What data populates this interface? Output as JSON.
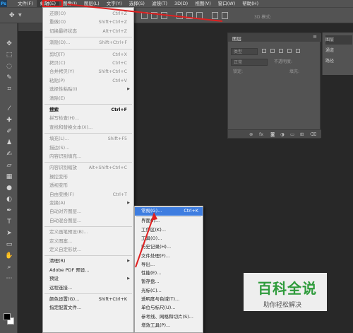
{
  "menubar": {
    "logo": "Ps",
    "items": [
      "文件(F)",
      "编辑(E)",
      "图像(I)",
      "图层(L)",
      "文字(Y)",
      "选择(S)",
      "滤镜(T)",
      "3D(D)",
      "视图(V)",
      "窗口(W)",
      "帮助(H)"
    ]
  },
  "optbar": {
    "three_d_mode": "3D 模式:"
  },
  "edit_menu": {
    "items": [
      {
        "label": "还原(O)",
        "shortcut": "Ctrl+Z",
        "disabled": true
      },
      {
        "label": "重做(O)",
        "shortcut": "Shift+Ctrl+Z",
        "disabled": true
      },
      {
        "label": "切换最终状态",
        "shortcut": "Alt+Ctrl+Z",
        "disabled": true
      },
      {
        "label": "渐隐(D)...",
        "shortcut": "Shift+Ctrl+F",
        "disabled": true
      },
      {
        "label": "剪切(T)",
        "shortcut": "Ctrl+X",
        "disabled": true
      },
      {
        "label": "拷贝(C)",
        "shortcut": "Ctrl+C",
        "disabled": true
      },
      {
        "label": "合并拷贝(Y)",
        "shortcut": "Shift+Ctrl+C",
        "disabled": true
      },
      {
        "label": "粘贴(P)",
        "shortcut": "Ctrl+V",
        "disabled": true
      },
      {
        "label": "选择性粘贴(I)",
        "shortcut": "",
        "disabled": true,
        "submenu": true
      },
      {
        "label": "清除(E)",
        "shortcut": "",
        "disabled": true
      },
      {
        "label": "搜索",
        "shortcut": "Ctrl+F",
        "disabled": false,
        "bold": true
      },
      {
        "label": "拼写检查(H)...",
        "shortcut": "",
        "disabled": true
      },
      {
        "label": "查找和替换文本(X)...",
        "shortcut": "",
        "disabled": true
      },
      {
        "label": "填充(L)...",
        "shortcut": "Shift+F5",
        "disabled": true
      },
      {
        "label": "描边(S)...",
        "shortcut": "",
        "disabled": true
      },
      {
        "label": "内容识别填充...",
        "shortcut": "",
        "disabled": true
      },
      {
        "label": "内容识别缩放",
        "shortcut": "Alt+Shift+Ctrl+C",
        "disabled": true
      },
      {
        "label": "操控变形",
        "shortcut": "",
        "disabled": true
      },
      {
        "label": "透视变形",
        "shortcut": "",
        "disabled": true
      },
      {
        "label": "自由变换(F)",
        "shortcut": "Ctrl+T",
        "disabled": true
      },
      {
        "label": "变换(A)",
        "shortcut": "",
        "disabled": true,
        "submenu": true
      },
      {
        "label": "自动对齐图层...",
        "shortcut": "",
        "disabled": true
      },
      {
        "label": "自动混合图层...",
        "shortcut": "",
        "disabled": true
      },
      {
        "label": "定义画笔预设(B)...",
        "shortcut": "",
        "disabled": true
      },
      {
        "label": "定义图案...",
        "shortcut": "",
        "disabled": true
      },
      {
        "label": "定义自定形状...",
        "shortcut": "",
        "disabled": true
      },
      {
        "label": "清理(R)",
        "shortcut": "",
        "disabled": false,
        "submenu": true
      },
      {
        "label": "Adobe PDF 预设...",
        "shortcut": "",
        "disabled": false
      },
      {
        "label": "预设",
        "shortcut": "",
        "disabled": false,
        "submenu": true
      },
      {
        "label": "远程连接...",
        "shortcut": "",
        "disabled": false
      },
      {
        "label": "颜色设置(G)...",
        "shortcut": "Shift+Ctrl+K",
        "disabled": false
      },
      {
        "label": "指定配置文件...",
        "shortcut": "",
        "disabled": false
      }
    ]
  },
  "prefs_submenu": {
    "items": [
      {
        "label": "常规(G)...",
        "shortcut": "Ctrl+K",
        "highlighted": true
      },
      {
        "label": "界面(I)...",
        "shortcut": ""
      },
      {
        "label": "工作区(K)...",
        "shortcut": ""
      },
      {
        "label": "工具(O)...",
        "shortcut": ""
      },
      {
        "label": "历史记录(H)...",
        "shortcut": ""
      },
      {
        "label": "文件处理(F)...",
        "shortcut": ""
      },
      {
        "label": "导出...",
        "shortcut": ""
      },
      {
        "label": "性能(E)...",
        "shortcut": ""
      },
      {
        "label": "暂存盘...",
        "shortcut": ""
      },
      {
        "label": "光标(C)...",
        "shortcut": ""
      },
      {
        "label": "透明度与色域(T)...",
        "shortcut": ""
      },
      {
        "label": "单位与标尺(U)...",
        "shortcut": ""
      },
      {
        "label": "参考线、网格和切片(S)...",
        "shortcut": ""
      },
      {
        "label": "增效工具(P)...",
        "shortcut": ""
      }
    ]
  },
  "layers_panel": {
    "tab": "图层",
    "kind": "类型",
    "blend": "正常",
    "opacity_label": "不透明度:",
    "lock_label": "锁定:",
    "fill_label": "填充:",
    "footer_icons": [
      "link-icon",
      "fx",
      "mask-icon",
      "adjust-icon",
      "folder-icon",
      "new-layer-icon",
      "trash-icon"
    ],
    "fx": "fx"
  },
  "side_strip": {
    "items": [
      "图层",
      "通道",
      "路径"
    ]
  },
  "watermark": {
    "title": "百科全说",
    "subtitle": "助你轻松解决"
  },
  "colors": {
    "highlight": "#3e7de0",
    "annotation": "#e02020",
    "watermark_green": "#2e9b3b"
  }
}
